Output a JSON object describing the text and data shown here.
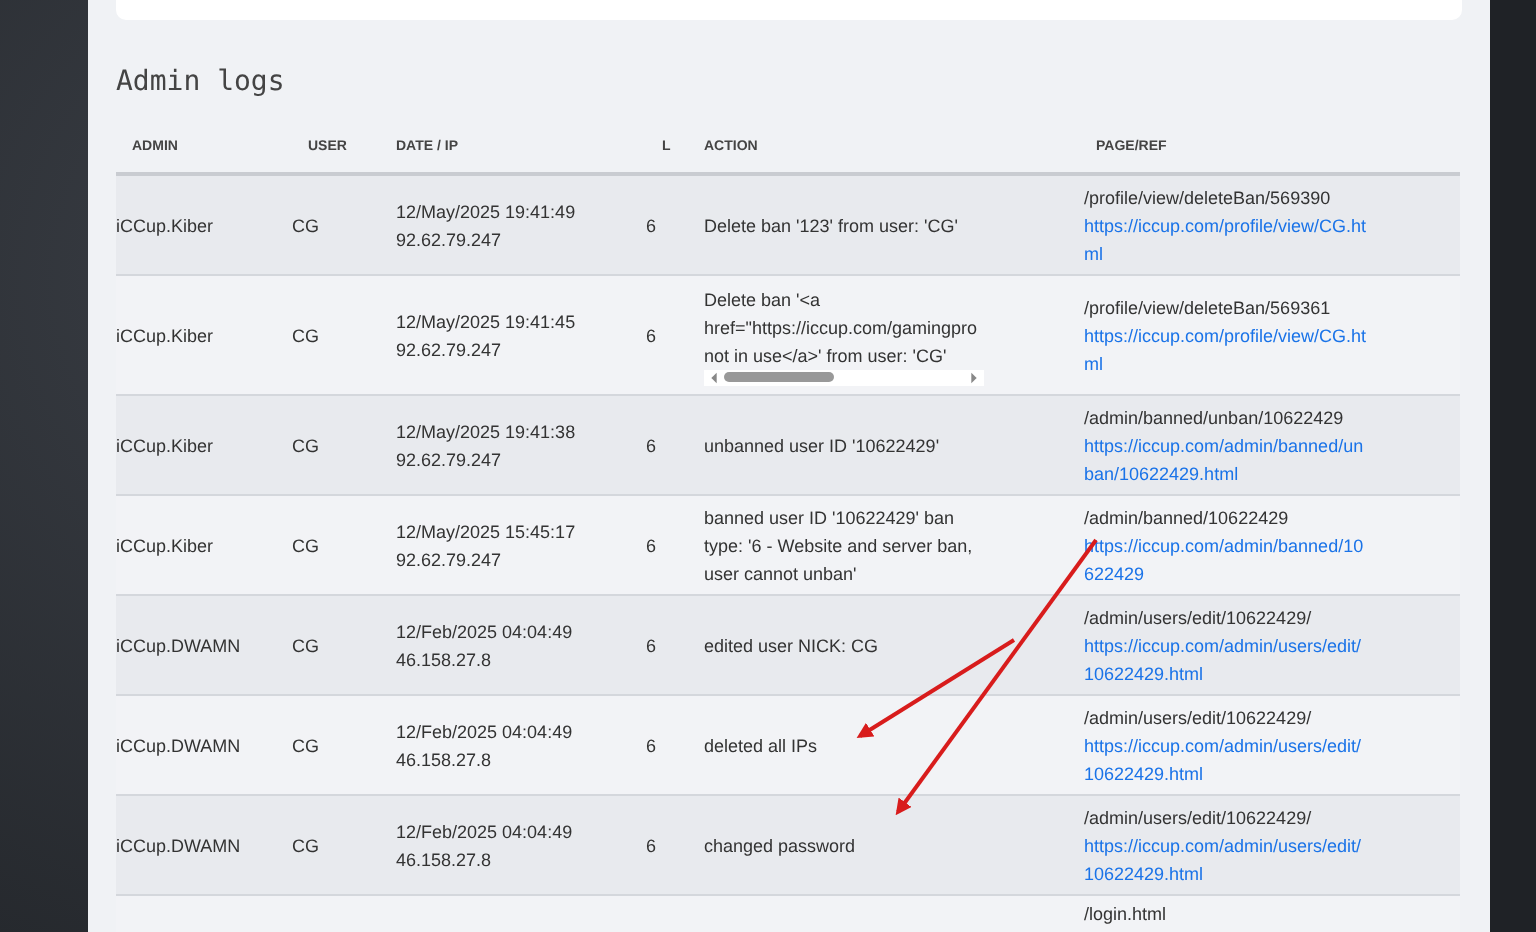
{
  "title": "Admin logs",
  "columns": [
    "ADMIN",
    "USER",
    "DATE / IP",
    "L",
    "ACTION",
    "PAGE/REF"
  ],
  "rows": [
    {
      "admin": "iCCup.Kiber",
      "user": "CG",
      "date": "12/May/2025 19:41:49",
      "ip": "92.62.79.247",
      "level": "6",
      "kind": "text",
      "action": [
        "Delete ban '123' from user: 'CG'"
      ],
      "page": "/profile/view/deleteBan/569390",
      "ref": "https://iccup.com/profile/view/CG.html"
    },
    {
      "admin": "iCCup.Kiber",
      "user": "CG",
      "date": "12/May/2025 19:41:45",
      "ip": "92.62.79.247",
      "level": "6",
      "kind": "scroll",
      "action": [
        "Delete ban '<a",
        "href=\"https://iccup.com/gamingpro",
        "not in use</a>' from user: 'CG'"
      ],
      "page": "/profile/view/deleteBan/569361",
      "ref": "https://iccup.com/profile/view/CG.html"
    },
    {
      "admin": "iCCup.Kiber",
      "user": "CG",
      "date": "12/May/2025 19:41:38",
      "ip": "92.62.79.247",
      "level": "6",
      "kind": "text",
      "action": [
        "unbanned user ID '10622429'"
      ],
      "page": "/admin/banned/unban/10622429",
      "ref": "https://iccup.com/admin/banned/unban/10622429.html"
    },
    {
      "admin": "iCCup.Kiber",
      "user": "CG",
      "date": "12/May/2025 15:45:17",
      "ip": "92.62.79.247",
      "level": "6",
      "kind": "text",
      "action": [
        "banned user ID '10622429' ban type: '6 - Website and server ban, user cannot unban'"
      ],
      "page": "/admin/banned/10622429",
      "ref": "https://iccup.com/admin/banned/10622429"
    },
    {
      "admin": "iCCup.DWAMN",
      "user": "CG",
      "date": "12/Feb/2025 04:04:49",
      "ip": "46.158.27.8",
      "level": "6",
      "kind": "text",
      "action": [
        "edited user NICK: CG"
      ],
      "page": "/admin/users/edit/10622429/",
      "ref": "https://iccup.com/admin/users/edit/10622429.html"
    },
    {
      "admin": "iCCup.DWAMN",
      "user": "CG",
      "date": "12/Feb/2025 04:04:49",
      "ip": "46.158.27.8",
      "level": "6",
      "kind": "text",
      "action": [
        "deleted all IPs"
      ],
      "page": "/admin/users/edit/10622429/",
      "ref": "https://iccup.com/admin/users/edit/10622429.html"
    },
    {
      "admin": "iCCup.DWAMN",
      "user": "CG",
      "date": "12/Feb/2025 04:04:49",
      "ip": "46.158.27.8",
      "level": "6",
      "kind": "text",
      "action": [
        "changed password"
      ],
      "page": "/admin/users/edit/10622429/",
      "ref": "https://iccup.com/admin/users/edit/10622429.html"
    },
    {
      "kind": "partial",
      "page": "/login.html"
    }
  ]
}
